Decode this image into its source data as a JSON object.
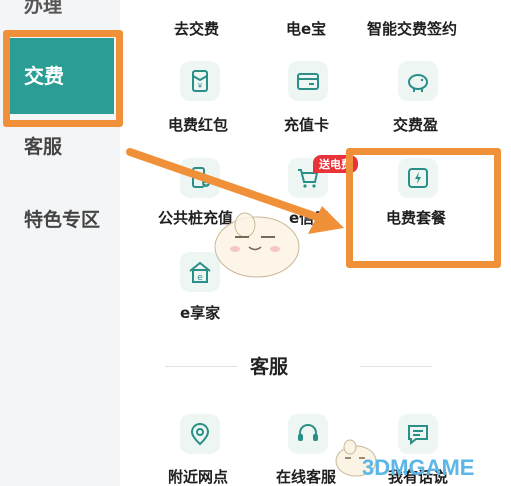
{
  "sidebar": {
    "items": [
      {
        "label": "办理"
      },
      {
        "label": "交费"
      },
      {
        "label": "客服"
      },
      {
        "label": "特色专区"
      }
    ]
  },
  "grid": {
    "row0": [
      "去交费",
      "电e宝",
      "智能交费签约"
    ],
    "row1": [
      "电费红包",
      "充值卡",
      "交费盈"
    ],
    "row2": [
      "公共桩充值",
      "e信用",
      "电费套餐"
    ],
    "row3": [
      "e享家"
    ]
  },
  "badge": {
    "label": "送电费"
  },
  "service_section": {
    "title": "客服",
    "items": [
      "附近网点",
      "在线客服",
      "我有话说"
    ]
  },
  "watermark": {
    "text": "3DMGAME"
  },
  "colors": {
    "accent": "#2a9d94",
    "highlight_border": "#f0913a",
    "badge": "#e8333a",
    "icon_stroke": "#2a8f86"
  }
}
